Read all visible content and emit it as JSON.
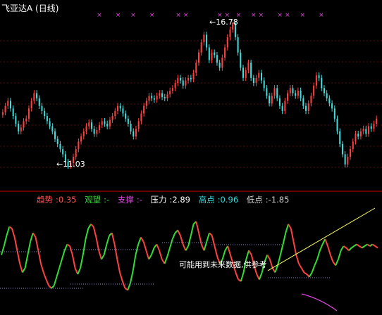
{
  "title": "飞亚达A (日线)",
  "indicators": {
    "trend": {
      "label": "趋势",
      "value": "0.35",
      "color": "#ff5555"
    },
    "watch": {
      "label": "观望",
      "value": "-",
      "color": "#33dd33"
    },
    "support": {
      "label": "支撑",
      "value": "-",
      "color": "#dd44dd"
    },
    "pressure": {
      "label": "压力",
      "value": "2.89",
      "color": "#ffffff"
    },
    "high": {
      "label": "高点",
      "value": "0.96",
      "color": "#33dddd"
    },
    "low": {
      "label": "低点",
      "value": "-1.85",
      "color": "#cccccc"
    }
  },
  "note": "可能用到未来数据,供参考",
  "annotations": {
    "max_label": "16.78",
    "min_label": "11.03"
  },
  "colors": {
    "up": "#ff4040",
    "down": "#40dddd",
    "marker": "#dd44dd",
    "pressure_line": "#ffff66",
    "divider": "#cc0000"
  },
  "chart_data": {
    "type": "candlestick",
    "title": "飞亚达A (日线)",
    "price_max": 16.78,
    "price_min": 11.03,
    "closes": [
      13.25,
      13.5,
      13.7,
      13.4,
      13.1,
      12.8,
      12.5,
      12.65,
      12.9,
      13.0,
      13.4,
      13.7,
      14.0,
      13.8,
      13.5,
      13.3,
      13.1,
      12.9,
      12.7,
      12.5,
      12.2,
      12.0,
      11.8,
      11.6,
      11.3,
      11.1,
      11.25,
      11.5,
      11.8,
      12.1,
      12.3,
      12.5,
      12.7,
      12.85,
      12.6,
      12.4,
      12.55,
      12.75,
      12.9,
      12.8,
      12.7,
      12.95,
      13.1,
      13.3,
      13.5,
      13.4,
      13.2,
      13.0,
      12.8,
      12.5,
      12.3,
      12.6,
      12.9,
      13.2,
      13.5,
      13.7,
      13.9,
      13.8,
      13.75,
      13.9,
      14.0,
      13.85,
      13.8,
      13.95,
      14.1,
      14.2,
      14.4,
      14.6,
      14.5,
      14.3,
      14.5,
      14.6,
      14.55,
      14.8,
      15.2,
      15.6,
      16.0,
      16.3,
      15.8,
      15.3,
      15.6,
      15.5,
      15.2,
      15.0,
      15.4,
      15.8,
      16.2,
      16.5,
      16.78,
      16.2,
      15.6,
      15.0,
      14.6,
      14.9,
      15.2,
      14.6,
      14.4,
      14.6,
      14.8,
      14.5,
      14.2,
      13.9,
      13.6,
      13.9,
      14.2,
      13.8,
      13.5,
      13.3,
      13.7,
      14.0,
      14.2,
      14.0,
      13.9,
      14.1,
      13.8,
      13.5,
      13.3,
      13.6,
      13.9,
      14.3,
      14.7,
      14.6,
      14.2,
      14.0,
      13.8,
      13.6,
      13.4,
      13.0,
      12.5,
      12.0,
      11.6,
      11.2,
      11.5,
      11.8,
      12.1,
      12.4,
      12.3,
      12.5,
      12.6,
      12.4,
      12.7,
      12.6,
      12.8,
      13.0
    ],
    "up_markers": [
      0.26,
      0.31,
      0.35,
      0.4,
      0.47,
      0.49,
      0.58,
      0.6,
      0.63,
      0.67,
      0.69,
      0.74,
      0.76,
      0.8,
      0.85
    ],
    "oscillator": [
      0.5,
      0.6,
      0.72,
      0.82,
      0.8,
      0.7,
      0.55,
      0.4,
      0.3,
      0.35,
      0.5,
      0.65,
      0.75,
      0.7,
      0.55,
      0.4,
      0.3,
      0.22,
      0.15,
      0.12,
      0.15,
      0.25,
      0.35,
      0.45,
      0.55,
      0.62,
      0.6,
      0.5,
      0.35,
      0.28,
      0.35,
      0.5,
      0.68,
      0.8,
      0.85,
      0.82,
      0.7,
      0.55,
      0.45,
      0.5,
      0.62,
      0.72,
      0.75,
      0.62,
      0.45,
      0.3,
      0.2,
      0.12,
      0.1,
      0.18,
      0.32,
      0.5,
      0.62,
      0.7,
      0.65,
      0.55,
      0.45,
      0.5,
      0.58,
      0.62,
      0.55,
      0.45,
      0.4,
      0.48,
      0.58,
      0.68,
      0.75,
      0.78,
      0.72,
      0.62,
      0.55,
      0.6,
      0.72,
      0.85,
      0.88,
      0.75,
      0.62,
      0.55,
      0.65,
      0.75,
      0.72,
      0.6,
      0.48,
      0.4,
      0.45,
      0.55,
      0.6,
      0.5,
      0.4,
      0.3,
      0.22,
      0.2,
      0.3,
      0.45,
      0.55,
      0.5,
      0.38,
      0.28,
      0.22,
      0.3,
      0.42,
      0.5,
      0.45,
      0.35,
      0.3,
      0.38,
      0.5,
      0.62,
      0.75,
      0.85,
      0.8,
      0.65,
      0.5,
      0.4,
      0.35,
      0.3,
      0.28,
      0.25,
      0.3,
      0.38,
      0.45,
      0.55,
      0.62,
      0.68,
      0.6,
      0.5,
      0.42,
      0.38,
      0.45,
      0.55,
      0.6,
      0.58,
      0.55,
      0.58,
      0.6,
      0.62,
      0.6,
      0.58,
      0.6,
      0.62,
      0.6,
      0.62,
      0.6,
      0.58
    ]
  }
}
